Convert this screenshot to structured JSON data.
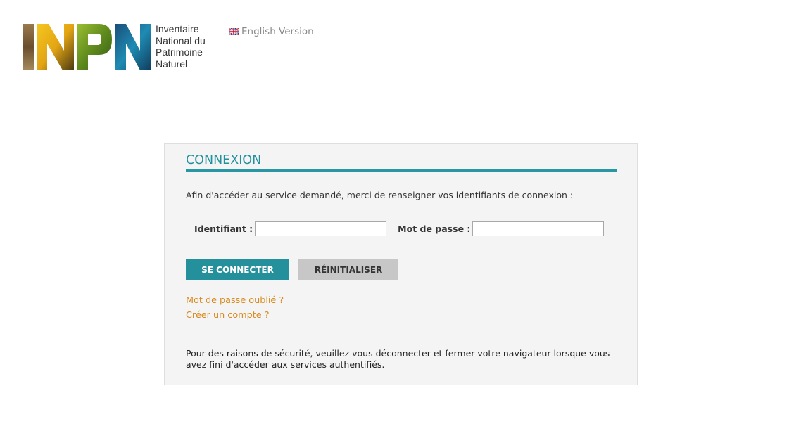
{
  "header": {
    "logo_letters": "INPN",
    "logo_lines": [
      "Inventaire",
      "National du",
      "Patrimoine",
      "Naturel"
    ],
    "language_link": "English Version",
    "flag_icon": "uk-flag-icon"
  },
  "login": {
    "title": "CONNEXION",
    "intro": "Afin d'accéder au service demandé, merci de renseigner vos identifiants de connexion :",
    "username_label": "Identifiant :",
    "username_value": "",
    "password_label": "Mot de passe :",
    "password_value": "",
    "connect_button": "SE CONNECTER",
    "reset_button": "RÉINITIALISER",
    "forgot_link": "Mot de passe oublié ?",
    "create_link": "Créer un compte ?",
    "security_note": "Pour des raisons de sécurité, veuillez vous déconnecter et fermer votre navigateur lorsque vous avez fini d'accéder aux services authentifiés."
  },
  "colors": {
    "accent": "#24909b",
    "link": "#d88a1c",
    "reset_button": "#c7c7c7",
    "panel_bg": "#f4f4f4"
  }
}
